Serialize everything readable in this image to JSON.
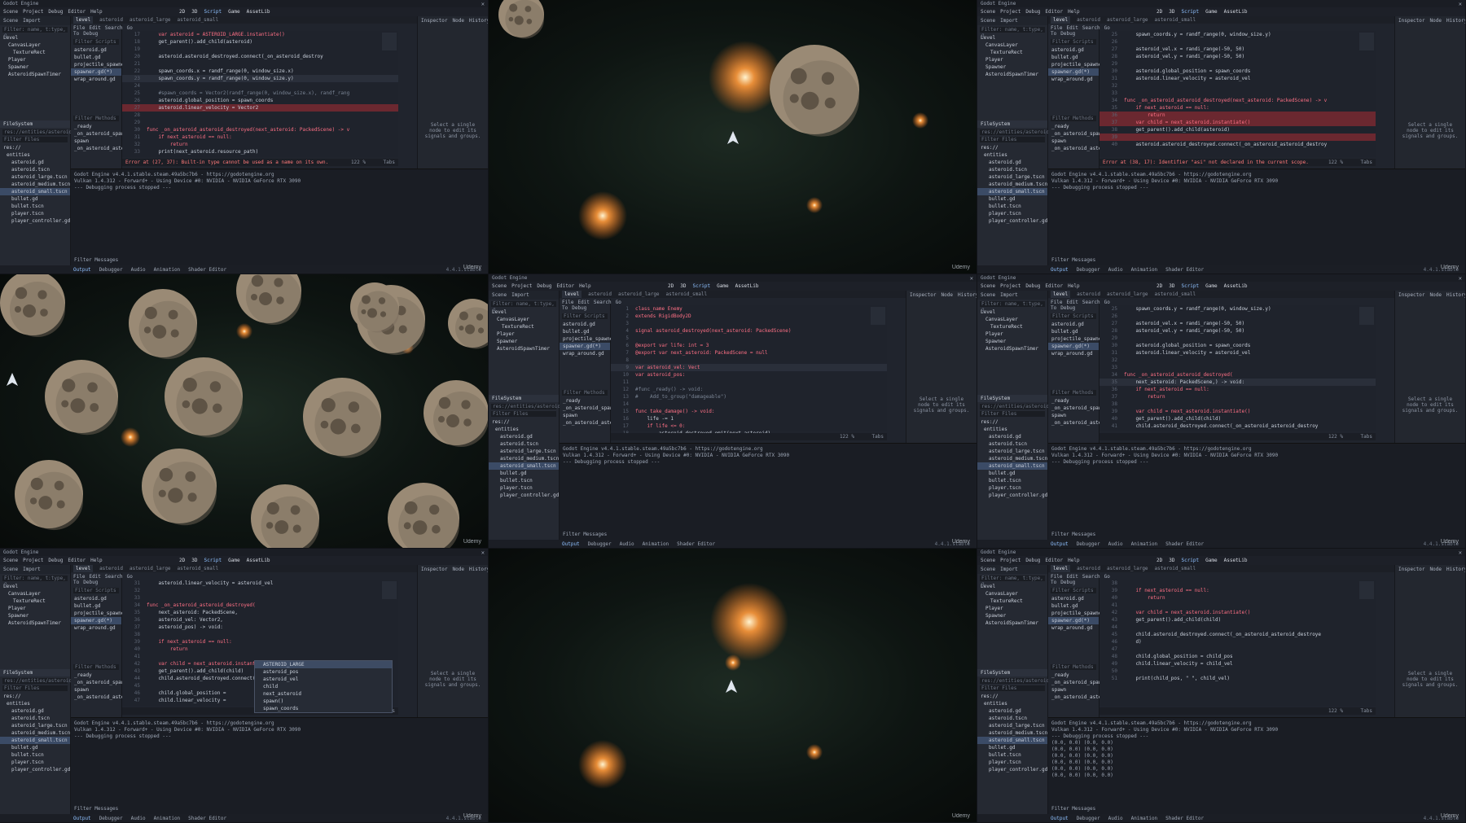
{
  "app": {
    "title": "Godot Engine",
    "menu": [
      "Scene",
      "Project",
      "Debug",
      "Editor",
      "Help"
    ],
    "workspaces": [
      "2D",
      "3D",
      "Script",
      "Game",
      "AssetLib"
    ],
    "renderer": "Forward+"
  },
  "dock": {
    "tabs": [
      "Scene",
      "Import"
    ],
    "filter_placeholder": "Filter: name, t:type, g",
    "tree": [
      "Level",
      "CanvasLayer",
      "TextureRect",
      "Player",
      "Spawner",
      "AsteroidSpawnTimer"
    ],
    "filesystem_label": "FileSystem",
    "path": "res://entities/asteroid_sm",
    "filter_files": "Filter Files",
    "files": [
      "res://",
      "entities",
      "asteroid.gd",
      "asteroid.tscn",
      "asteroid_large.tscn",
      "asteroid_medium.tscn",
      "asteroid_small.tscn",
      "bullet.gd",
      "bullet.tscn",
      "player.tscn",
      "player_controller.gd"
    ]
  },
  "scripts": {
    "filter_scripts": "Filter Scripts",
    "items": [
      "asteroid.gd",
      "bullet.gd",
      "projectile_spawner.gd",
      "spawner.gd(*)",
      "wrap_around.gd"
    ],
    "filter_methods": "Filter Methods",
    "methods": [
      "_ready",
      "_on_asteroid_spawn_timer",
      "spawn",
      "_on_asteroid_asteroid_des"
    ]
  },
  "filetabs": [
    "level",
    "asteroid",
    "asteroid_large",
    "asteroid_small"
  ],
  "editor_menu": [
    "File",
    "Edit",
    "Search",
    "Go To",
    "Debug"
  ],
  "code_panels": {
    "c0": [
      {
        "n": "17",
        "t": "    var asteroid = ASTEROID_LARGE.instantiate()"
      },
      {
        "n": "18",
        "t": "    get_parent().add_child(asteroid)"
      },
      {
        "n": "19",
        "t": ""
      },
      {
        "n": "20",
        "t": "    asteroid.asteroid_destroyed.connect(_on_asteroid_destroy"
      },
      {
        "n": "21",
        "t": ""
      },
      {
        "n": "22",
        "t": "    spawn_coords.x = randf_range(0, window_size.x)"
      },
      {
        "n": "23",
        "t": "    spawn_coords.y = randf_range(0, window_size.y)"
      },
      {
        "n": "24",
        "t": ""
      },
      {
        "n": "25",
        "t": "    #spawn_coords = Vector2(randf_range(0, window_size.x), randf_rang"
      },
      {
        "n": "26",
        "t": "    asteroid.global_position = spawn_coords"
      },
      {
        "n": "27",
        "t": "    asteroid.linear_velocity = Vector2"
      },
      {
        "n": "28",
        "t": ""
      },
      {
        "n": "29",
        "t": ""
      },
      {
        "n": "30",
        "t": "func _on_asteroid_asteroid_destroyed(next_asteroid: PackedScene) -> v"
      },
      {
        "n": "31",
        "t": "    if next_asteroid == null:"
      },
      {
        "n": "32",
        "t": "        return"
      },
      {
        "n": "33",
        "t": "    print(next_asteroid.resource_path)"
      }
    ],
    "c2": [
      {
        "n": "25",
        "t": "    spawn_coords.y = randf_range(0, window_size.y)"
      },
      {
        "n": "26",
        "t": ""
      },
      {
        "n": "27",
        "t": "    asteroid_vel.x = randi_range(-50, 50)"
      },
      {
        "n": "28",
        "t": "    asteroid_vel.y = randi_range(-50, 50)"
      },
      {
        "n": "29",
        "t": ""
      },
      {
        "n": "30",
        "t": "    asteroid.global_position = spawn_coords"
      },
      {
        "n": "31",
        "t": "    asteroid.linear_velocity = asteroid_vel"
      },
      {
        "n": "32",
        "t": ""
      },
      {
        "n": "33",
        "t": ""
      },
      {
        "n": "34",
        "t": "func _on_asteroid_asteroid_destroyed(next_asteroid: PackedScene) -> v"
      },
      {
        "n": "35",
        "t": "    if next_asteroid == null:"
      },
      {
        "n": "36",
        "t": "        return"
      },
      {
        "n": "37",
        "t": "    var child = next_asteroid.instantiate()"
      },
      {
        "n": "38",
        "t": "    get_parent().add_child(asteroid)"
      },
      {
        "n": "39",
        "t": ""
      },
      {
        "n": "40",
        "t": "    asteroid.asteroid_destroyed.connect(_on_asteroid_asteroid_destroy"
      }
    ],
    "c4": [
      {
        "n": "1",
        "t": "class_name Enemy"
      },
      {
        "n": "2",
        "t": "extends RigidBody2D"
      },
      {
        "n": "3",
        "t": ""
      },
      {
        "n": "4",
        "t": "signal asteroid_destroyed(next_asteroid: PackedScene)"
      },
      {
        "n": "5",
        "t": ""
      },
      {
        "n": "6",
        "t": "@export var life: int = 3"
      },
      {
        "n": "7",
        "t": "@export var next_asteroid: PackedScene = null"
      },
      {
        "n": "8",
        "t": ""
      },
      {
        "n": "9",
        "t": "var asteroid_vel: Vect"
      },
      {
        "n": "10",
        "t": "var asteroid_pos:"
      },
      {
        "n": "11",
        "t": ""
      },
      {
        "n": "12",
        "t": "#func _ready() -> void:"
      },
      {
        "n": "13",
        "t": "#    Add_to_group(\"damageable\")"
      },
      {
        "n": "14",
        "t": ""
      },
      {
        "n": "15",
        "t": "func take_damage() -> void:"
      },
      {
        "n": "16",
        "t": "    life -= 1"
      },
      {
        "n": "17",
        "t": "    if life <= 0:"
      },
      {
        "n": "18",
        "t": "        asteroid_destroyed.emit(next_asteroid)"
      }
    ],
    "c5": [
      {
        "n": "25",
        "t": "    spawn_coords.y = randf_range(0, window_size.y)"
      },
      {
        "n": "26",
        "t": ""
      },
      {
        "n": "27",
        "t": "    asteroid_vel.x = randi_range(-50, 50)"
      },
      {
        "n": "28",
        "t": "    asteroid_vel.y = randi_range(-50, 50)"
      },
      {
        "n": "29",
        "t": ""
      },
      {
        "n": "30",
        "t": "    asteroid.global_position = spawn_coords"
      },
      {
        "n": "31",
        "t": "    asteroid.linear_velocity = asteroid_vel"
      },
      {
        "n": "32",
        "t": ""
      },
      {
        "n": "33",
        "t": ""
      },
      {
        "n": "34",
        "t": "func _on_asteroid_asteroid_destroyed("
      },
      {
        "n": "35",
        "t": "    next_asteroid: PackedScene,) -> void:"
      },
      {
        "n": "36",
        "t": "    if next_asteroid == null:"
      },
      {
        "n": "37",
        "t": "        return"
      },
      {
        "n": "38",
        "t": ""
      },
      {
        "n": "39",
        "t": "    var child = next_asteroid.instantiate()"
      },
      {
        "n": "40",
        "t": "    get_parent().add_child(child)"
      },
      {
        "n": "41",
        "t": "    child.asteroid_destroyed.connect(_on_asteroid_asteroid_destroy"
      }
    ],
    "c6": [
      {
        "n": "31",
        "t": "    asteroid.linear_velocity = asteroid_vel"
      },
      {
        "n": "32",
        "t": ""
      },
      {
        "n": "33",
        "t": ""
      },
      {
        "n": "34",
        "t": "func _on_asteroid_asteroid_destroyed("
      },
      {
        "n": "35",
        "t": "    next_asteroid: PackedScene,"
      },
      {
        "n": "36",
        "t": "    asteroid_vel: Vector2,"
      },
      {
        "n": "37",
        "t": "    asteroid_pos) -> void:"
      },
      {
        "n": "38",
        "t": ""
      },
      {
        "n": "39",
        "t": "    if next_asteroid == null:"
      },
      {
        "n": "40",
        "t": "        return"
      },
      {
        "n": "41",
        "t": ""
      },
      {
        "n": "42",
        "t": "    var child = next_asteroid.instantiate()"
      },
      {
        "n": "43",
        "t": "    get_parent().add_child(child)"
      },
      {
        "n": "44",
        "t": "    child.asteroid_destroyed.connect(_on_asteroid_asteroid_destroy"
      },
      {
        "n": "45",
        "t": ""
      },
      {
        "n": "46",
        "t": "    child.global_position = "
      },
      {
        "n": "47",
        "t": "    child.linear_velocity = "
      }
    ],
    "c8": [
      {
        "n": "38",
        "t": ""
      },
      {
        "n": "39",
        "t": "    if next_asteroid == null:"
      },
      {
        "n": "40",
        "t": "        return"
      },
      {
        "n": "41",
        "t": ""
      },
      {
        "n": "42",
        "t": "    var child = next_asteroid.instantiate()"
      },
      {
        "n": "43",
        "t": "    get_parent().add_child(child)"
      },
      {
        "n": "44",
        "t": ""
      },
      {
        "n": "45",
        "t": "    child.asteroid_destroyed.connect(_on_asteroid_asteroid_destroye"
      },
      {
        "n": "46",
        "t": "    d)"
      },
      {
        "n": "47",
        "t": ""
      },
      {
        "n": "48",
        "t": "    child.global_position = child_pos"
      },
      {
        "n": "49",
        "t": "    child.linear_velocity = child_vel"
      },
      {
        "n": "50",
        "t": ""
      },
      {
        "n": "51",
        "t": "    print(child_pos, \" \", child_vel)"
      }
    ]
  },
  "autocomplete": [
    "ASTEROID_LARGE",
    "asteroid_pos",
    "asteroid_vel",
    "child",
    "next_asteroid",
    "spawn()",
    "spawn_coords"
  ],
  "statusbar": {
    "c0": "Error at (27, 37): Built-in type cannot be used as a name on its own.",
    "c2": "Error at (38, 17): Identifier \"asi\" not declared in the current scope.",
    "zoom": "122 %",
    "tabs": "Tabs"
  },
  "output": {
    "lines": [
      "Godot Engine v4.4.1.stable.steam.49a5bc7b6 - https://godotengine.org",
      "Vulkan 1.4.312 - Forward+ - Using Device #0: NVIDIA - NVIDIA GeForce RTX 3090",
      "--- Debugging process stopped ---"
    ],
    "values": [
      "(0.0, 0.0) (0.0, 0.0)",
      "(0.0, 0.0) (0.0, 0.0)",
      "(0.0, 0.0) (0.0, 0.0)",
      "(0.0, 0.0) (0.0, 0.0)",
      "(0.0, 0.0) (0.0, 0.0)",
      "(0.0, 0.0) (0.0, 0.0)"
    ],
    "filter": "Filter Messages"
  },
  "inspector": {
    "tabs": [
      "Inspector",
      "Node",
      "History"
    ],
    "hint": "Select a single node to edit its signals and groups."
  },
  "bottom_tabs": [
    "Output",
    "Debugger",
    "Audio",
    "Animation",
    "Shader Editor"
  ],
  "version": "4.4.1.stable",
  "watermark": "Udemy",
  "colors": {
    "accent": "#8fc1ff",
    "error_line": "#6b2830",
    "keyword": "#ff7085",
    "function": "#63e2a9"
  }
}
